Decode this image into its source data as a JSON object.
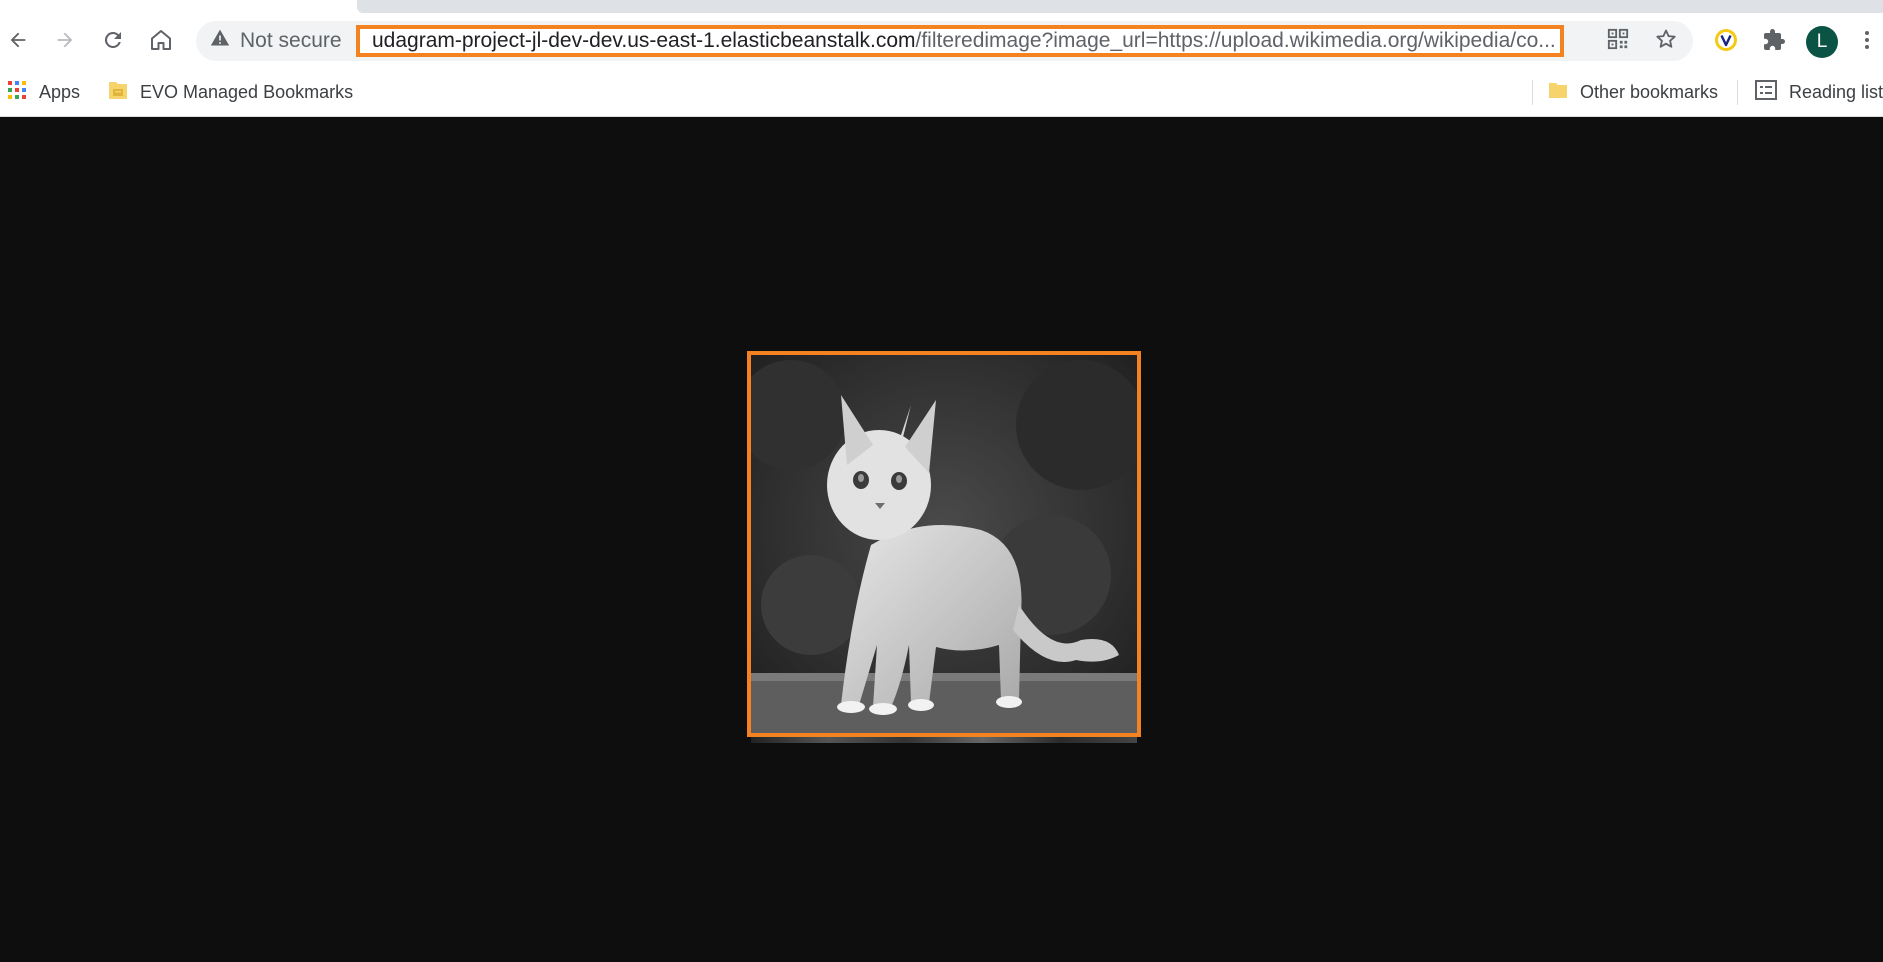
{
  "toolbar": {
    "back_icon": "arrow-left-icon",
    "forward_icon": "arrow-right-icon",
    "reload_icon": "reload-icon",
    "home_icon": "home-icon"
  },
  "omnibox": {
    "security_icon": "warning-triangle-icon",
    "security_label": "Not secure",
    "url_host": "udagram-project-jl-dev-dev.us-east-1.elasticbeanstalk.com",
    "url_path": "/filteredimage?image_url=https://upload.wikimedia.org/wikipedia/co...",
    "qr_icon": "qr-code-icon",
    "bookmark_icon": "star-icon"
  },
  "extensions": {
    "extension_icon": "v-extension-icon",
    "puzzle_icon": "puzzle-icon",
    "profile_initial": "L",
    "menu_icon": "kebab-menu-icon"
  },
  "bookmarks_bar": {
    "apps_label": "Apps",
    "managed_label": "EVO Managed Bookmarks",
    "other_label": "Other bookmarks",
    "reading_label": "Reading list"
  },
  "colors": {
    "highlight": "#f58220",
    "page_background": "#0e0e0e",
    "avatar": "#0b5345"
  },
  "content": {
    "image_description": "grayscale-kitten"
  }
}
